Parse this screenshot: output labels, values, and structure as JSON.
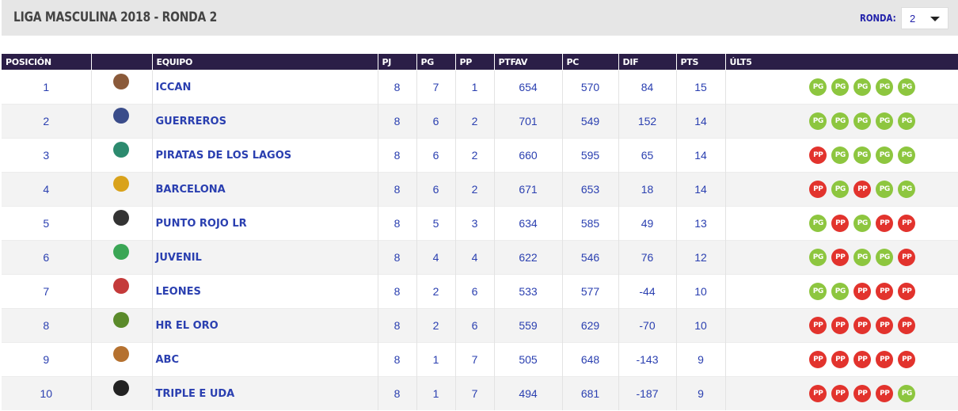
{
  "header": {
    "title": "LIGA MASCULINA 2018 - RONDA 2",
    "ronda_label": "RONDA:",
    "ronda_value": "2"
  },
  "columns": [
    "POSICIÓN",
    "",
    "EQUIPO",
    "PJ",
    "PG",
    "PP",
    "PTFAV",
    "PC",
    "DIF",
    "PTS",
    "ÚLT5"
  ],
  "colors": {
    "header_bg": "#2b1e47",
    "link": "#2a3fb0",
    "win": "#8dc63f",
    "loss": "#e2332d"
  },
  "rows": [
    {
      "pos": "1",
      "team": "ICCAN",
      "pj": "8",
      "pg": "7",
      "pp": "1",
      "ptfav": "654",
      "pc": "570",
      "dif": "84",
      "pts": "15",
      "last5": [
        "PG",
        "PG",
        "PG",
        "PG",
        "PG"
      ],
      "logo_icon": "iccan-logo-icon",
      "logo_color": "#8a5a3a"
    },
    {
      "pos": "2",
      "team": "GUERREROS",
      "pj": "8",
      "pg": "6",
      "pp": "2",
      "ptfav": "701",
      "pc": "549",
      "dif": "152",
      "pts": "14",
      "last5": [
        "PG",
        "PG",
        "PG",
        "PG",
        "PG"
      ],
      "logo_icon": "guerreros-logo-icon",
      "logo_color": "#3a4c8a"
    },
    {
      "pos": "3",
      "team": "PIRATAS DE LOS LAGOS",
      "pj": "8",
      "pg": "6",
      "pp": "2",
      "ptfav": "660",
      "pc": "595",
      "dif": "65",
      "pts": "14",
      "last5": [
        "PP",
        "PG",
        "PG",
        "PG",
        "PG"
      ],
      "logo_icon": "piratas-logo-icon",
      "logo_color": "#2c8a6e"
    },
    {
      "pos": "4",
      "team": "BARCELONA",
      "pj": "8",
      "pg": "6",
      "pp": "2",
      "ptfav": "671",
      "pc": "653",
      "dif": "18",
      "pts": "14",
      "last5": [
        "PP",
        "PG",
        "PP",
        "PG",
        "PG"
      ],
      "logo_icon": "barcelona-logo-icon",
      "logo_color": "#d9a21b"
    },
    {
      "pos": "5",
      "team": "PUNTO ROJO LR",
      "pj": "8",
      "pg": "5",
      "pp": "3",
      "ptfav": "634",
      "pc": "585",
      "dif": "49",
      "pts": "13",
      "last5": [
        "PG",
        "PP",
        "PG",
        "PP",
        "PP"
      ],
      "logo_icon": "punto-rojo-logo-icon",
      "logo_color": "#333333"
    },
    {
      "pos": "6",
      "team": "JUVENIL",
      "pj": "8",
      "pg": "4",
      "pp": "4",
      "ptfav": "622",
      "pc": "546",
      "dif": "76",
      "pts": "12",
      "last5": [
        "PG",
        "PP",
        "PG",
        "PG",
        "PP"
      ],
      "logo_icon": "juvenil-logo-icon",
      "logo_color": "#3aa655"
    },
    {
      "pos": "7",
      "team": "LEONES",
      "pj": "8",
      "pg": "2",
      "pp": "6",
      "ptfav": "533",
      "pc": "577",
      "dif": "-44",
      "pts": "10",
      "last5": [
        "PG",
        "PG",
        "PP",
        "PP",
        "PP"
      ],
      "logo_icon": "leones-logo-icon",
      "logo_color": "#c43a3a"
    },
    {
      "pos": "8",
      "team": "HR EL ORO",
      "pj": "8",
      "pg": "2",
      "pp": "6",
      "ptfav": "559",
      "pc": "629",
      "dif": "-70",
      "pts": "10",
      "last5": [
        "PP",
        "PP",
        "PP",
        "PP",
        "PP"
      ],
      "logo_icon": "hr-el-oro-logo-icon",
      "logo_color": "#5a8a2a"
    },
    {
      "pos": "9",
      "team": "ABC",
      "pj": "8",
      "pg": "1",
      "pp": "7",
      "ptfav": "505",
      "pc": "648",
      "dif": "-143",
      "pts": "9",
      "last5": [
        "PP",
        "PP",
        "PP",
        "PP",
        "PP"
      ],
      "logo_icon": "abc-logo-icon",
      "logo_color": "#b5712f"
    },
    {
      "pos": "10",
      "team": "TRIPLE E UDA",
      "pj": "8",
      "pg": "1",
      "pp": "7",
      "ptfav": "494",
      "pc": "681",
      "dif": "-187",
      "pts": "9",
      "last5": [
        "PP",
        "PP",
        "PP",
        "PP",
        "PG"
      ],
      "logo_icon": "triple-e-logo-icon",
      "logo_color": "#222222"
    }
  ]
}
